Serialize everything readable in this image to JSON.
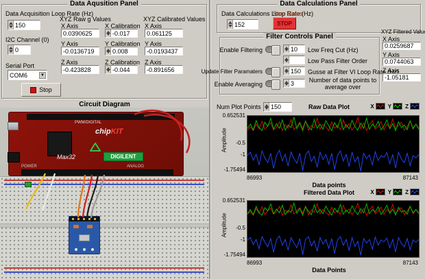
{
  "acquisition": {
    "title": "Data Aqusition Panel",
    "loop_label": "Data Acquisition Loop Rate (Hz)",
    "loop_value": "150",
    "raw_header": "XYZ Raw g Values",
    "raw": [
      {
        "label": "X Axis",
        "value": "0.0390625"
      },
      {
        "label": "Y Axis",
        "value": "-0.0136719"
      },
      {
        "label": "Z Axis",
        "value": "-0.423828"
      }
    ],
    "calibration": [
      {
        "label": "X Calibration",
        "value": "-0.017"
      },
      {
        "label": "Y Calibration",
        "value": "0.008"
      },
      {
        "label": "Z Calibration",
        "value": "-0.044"
      }
    ],
    "calibrated_header": "XYZ Calibrated Values",
    "calibrated": [
      {
        "label": "X Axis",
        "value": "0.061125"
      },
      {
        "label": "Y Axis",
        "value": "-0.0193437"
      },
      {
        "label": "Z Axis",
        "value": "-0.891656"
      }
    ],
    "i2c_label": "I2C Channel (0)",
    "i2c_value": "0",
    "serial_label": "Serial Port",
    "serial_value": "COM6",
    "stop_label": "Stop"
  },
  "circuit": {
    "title": "Circuit Diagram",
    "chip": "chip",
    "kit": "KIT",
    "board_name": "Max32",
    "brand": "DIGILENT",
    "label_pwm": "PWM/DIGITAL",
    "label_power": "POWER",
    "label_analog": "ANALOG"
  },
  "calculations": {
    "title": "Data Calculations Panel",
    "loop_label": "Data Calculations Loop Rate (Hz)",
    "loop_value": "152",
    "stop_calcs_label": "Stop Calcs",
    "stop_button_label": "STOP"
  },
  "filter": {
    "title": "Filter Controls Panel",
    "rows": [
      {
        "toggle": "Enable Filtering",
        "value": "10",
        "label": "Low Freq Cut (Hz)"
      },
      {
        "toggle": "",
        "value": "",
        "label": "Low Pass Filter Order"
      },
      {
        "toggle": "Update Filter Paramaters",
        "value": "150",
        "label": "Gusse at Filter VI Loop Rate (Hz)"
      },
      {
        "toggle": "Enable Averaging",
        "value": "3",
        "label": "Number of data points to average over"
      }
    ]
  },
  "filtered_values": {
    "header": "XYZ Filtered Values",
    "items": [
      {
        "label": "X Axis",
        "value": "0.0259687"
      },
      {
        "label": "Y Axis",
        "value": "0.0744063"
      },
      {
        "label": "Z Axis",
        "value": "-1.05181"
      }
    ]
  },
  "plots": {
    "num_points_label": "Num Plot Points",
    "num_points_value": "150",
    "legend": [
      {
        "label": "X",
        "color": "#cc1100"
      },
      {
        "label": "Y",
        "color": "#00bb00"
      },
      {
        "label": "Z",
        "color": "#2244ee"
      }
    ],
    "raw": {
      "title": "Raw Data Plot",
      "ylabel": "Amplitude",
      "xlabel": "Data points",
      "ytick_top": "0.652531",
      "ytick_mid1": "-0.5",
      "ytick_mid2": "-1",
      "ytick_bot": "-1.75494",
      "xtick_left": "86993",
      "xtick_right": "87143"
    },
    "filtered": {
      "title": "Filtered Data Plot",
      "ylabel": "Amplitude",
      "xlabel": "Data Points",
      "ytick_top": "0.652531",
      "ytick_mid1": "-0.5",
      "ytick_mid2": "-1",
      "ytick_bot": "-1.75494",
      "xtick_left": "86993",
      "xtick_right": "87143"
    }
  },
  "chart_data": [
    {
      "type": "line",
      "title": "Raw Data Plot",
      "xlabel": "Data points",
      "ylabel": "Amplitude",
      "xlim": [
        86993,
        87143
      ],
      "ylim": [
        -1.75494,
        0.652531
      ],
      "yticks": [
        0.652531,
        -0.5,
        -1,
        -1.75494
      ],
      "xticks": [
        86993,
        87143
      ],
      "legend_position": "top-right",
      "grid": false,
      "series": [
        {
          "name": "X",
          "color": "#cc1100",
          "values": [
            0.05,
            0.18,
            0.02,
            0.3,
            0.1,
            0.42,
            0.08,
            0.22,
            0.35,
            0.05,
            0.15,
            0.4,
            0.02,
            0.28,
            0.12,
            0.5,
            0.06,
            0.2,
            0.38,
            0.1,
            0.45,
            0.03,
            0.25,
            0.14,
            0.55,
            0.08,
            0.3,
            0.18,
            0.02,
            0.4,
            0.12,
            0.26,
            0.06,
            0.48,
            0.15,
            0.32,
            0.04,
            0.22,
            0.58,
            0.1,
            0.35,
            0.02,
            0.28,
            0.45,
            0.08,
            0.2,
            0.4,
            0.05,
            0.3,
            0.15,
            0.52,
            0.1,
            0.24,
            0.38,
            0.04,
            0.18,
            0.44,
            0.08,
            0.3,
            0.12
          ]
        },
        {
          "name": "Y",
          "color": "#00bb00",
          "values": [
            0.12,
            0.3,
            0.05,
            0.45,
            0.15,
            0.02,
            0.38,
            0.2,
            0.55,
            0.08,
            0.32,
            0.12,
            0.48,
            0.04,
            0.25,
            0.15,
            0.6,
            0.1,
            0.35,
            0.02,
            0.42,
            0.18,
            0.05,
            0.5,
            0.12,
            0.3,
            0.08,
            0.45,
            0.22,
            0.02,
            0.36,
            0.14,
            0.52,
            0.06,
            0.28,
            0.1,
            0.46,
            0.2,
            0.04,
            0.34,
            0.12,
            0.56,
            0.08,
            0.3,
            0.16,
            0.42,
            0.05,
            0.22,
            0.48,
            0.1,
            0.32,
            0.02,
            0.4,
            0.15,
            0.26,
            0.06,
            0.44,
            0.12,
            0.3,
            0.08
          ]
        },
        {
          "name": "Z",
          "color": "#2244ee",
          "values": [
            -1.05,
            -0.9,
            -1.25,
            -1.0,
            -1.45,
            -0.85,
            -1.15,
            -1.35,
            -0.95,
            -1.6,
            -1.05,
            -0.82,
            -1.28,
            -1.0,
            -1.5,
            -0.9,
            -1.18,
            -1.38,
            -0.95,
            -1.7,
            -1.02,
            -0.85,
            -1.3,
            -1.08,
            -1.55,
            -0.9,
            -1.22,
            -1.0,
            -1.42,
            -0.95,
            -1.65,
            -1.05,
            -0.85,
            -1.28,
            -1.0,
            -1.52,
            -0.9,
            -1.32,
            -1.1,
            -1.72,
            -0.95,
            -1.18,
            -1.02,
            -1.46,
            -0.88,
            -1.26,
            -1.05,
            -1.12,
            -0.92,
            -1.4,
            -1.0,
            -1.58,
            -0.9,
            -1.2,
            -1.35,
            -0.95,
            -1.48,
            -1.05,
            -1.15,
            -1.0
          ]
        }
      ]
    },
    {
      "type": "line",
      "title": "Filtered Data Plot",
      "xlabel": "Data Points",
      "ylabel": "Amplitude",
      "xlim": [
        86993,
        87143
      ],
      "ylim": [
        -1.75494,
        0.652531
      ],
      "yticks": [
        0.652531,
        -0.5,
        -1,
        -1.75494
      ],
      "xticks": [
        86993,
        87143
      ],
      "legend_position": "top-right",
      "grid": false,
      "series": [
        {
          "name": "X",
          "color": "#cc1100",
          "values": [
            0.08,
            0.2,
            0.04,
            0.32,
            0.12,
            0.4,
            0.06,
            0.24,
            0.33,
            0.08,
            0.18,
            0.42,
            0.04,
            0.26,
            0.14,
            0.48,
            0.08,
            0.22,
            0.36,
            0.12,
            0.43,
            0.05,
            0.27,
            0.16,
            0.52,
            0.1,
            0.28,
            0.16,
            0.04,
            0.38,
            0.14,
            0.24,
            0.08,
            0.46,
            0.17,
            0.3,
            0.06,
            0.24,
            0.55,
            0.12,
            0.33,
            0.04,
            0.26,
            0.43,
            0.1,
            0.22,
            0.38,
            0.07,
            0.28,
            0.17,
            0.5,
            0.12,
            0.26,
            0.36,
            0.06,
            0.2,
            0.42,
            0.1,
            0.28,
            0.14
          ]
        },
        {
          "name": "Y",
          "color": "#00bb00",
          "values": [
            0.1,
            0.28,
            0.06,
            0.42,
            0.14,
            0.04,
            0.36,
            0.22,
            0.52,
            0.1,
            0.3,
            0.14,
            0.46,
            0.06,
            0.24,
            0.16,
            0.56,
            0.12,
            0.33,
            0.04,
            0.4,
            0.2,
            0.06,
            0.48,
            0.14,
            0.28,
            0.1,
            0.43,
            0.2,
            0.04,
            0.34,
            0.16,
            0.5,
            0.08,
            0.26,
            0.12,
            0.44,
            0.22,
            0.06,
            0.32,
            0.14,
            0.53,
            0.1,
            0.28,
            0.18,
            0.4,
            0.07,
            0.24,
            0.46,
            0.12,
            0.3,
            0.04,
            0.38,
            0.17,
            0.24,
            0.08,
            0.42,
            0.14,
            0.28,
            0.1
          ]
        },
        {
          "name": "Z",
          "color": "#2244ee",
          "values": [
            -1.02,
            -0.92,
            -1.22,
            -1.0,
            -1.4,
            -0.88,
            -1.12,
            -1.32,
            -0.96,
            -1.55,
            -1.02,
            -0.85,
            -1.25,
            -1.0,
            -1.46,
            -0.92,
            -1.15,
            -1.35,
            -0.96,
            -1.66,
            -1.0,
            -0.88,
            -1.28,
            -1.06,
            -1.5,
            -0.92,
            -1.2,
            -1.0,
            -1.38,
            -0.96,
            -1.6,
            -1.02,
            -0.88,
            -1.25,
            -1.0,
            -1.48,
            -0.92,
            -1.3,
            -1.08,
            -1.68,
            -0.96,
            -1.16,
            -1.0,
            -1.42,
            -0.9,
            -1.24,
            -1.02,
            -1.1,
            -0.94,
            -1.36,
            -1.0,
            -1.54,
            -0.92,
            -1.18,
            -1.32,
            -0.96,
            -1.44,
            -1.02,
            -1.12,
            -1.0
          ]
        }
      ]
    }
  ]
}
